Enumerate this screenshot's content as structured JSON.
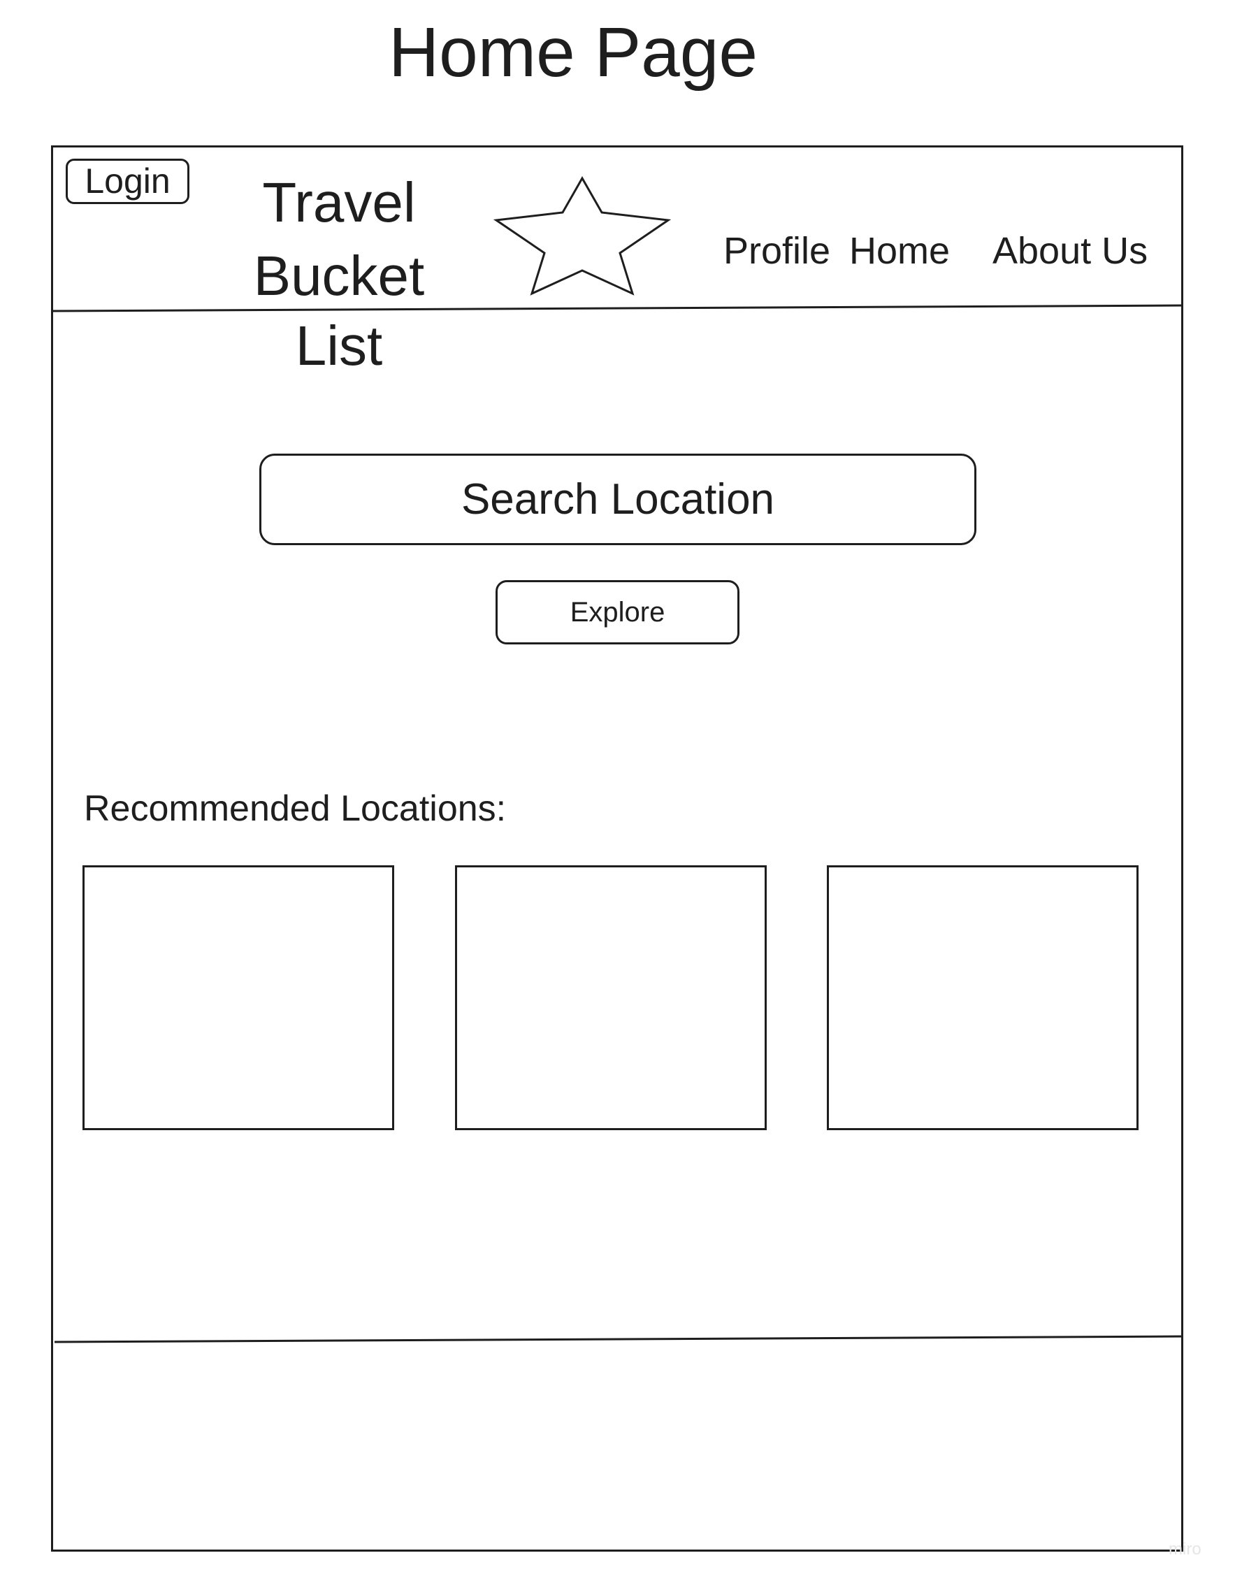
{
  "page_title": "Home Page",
  "header": {
    "login_label": "Login",
    "brand_line1": "Travel",
    "brand_line2": "Bucket List",
    "logo_icon": "star-icon",
    "nav": {
      "profile": "Profile",
      "home": "Home",
      "about": "About Us"
    }
  },
  "search": {
    "placeholder": "Search Location",
    "button_label": "Explore"
  },
  "recommended": {
    "label": "Recommended Locations:",
    "card_count": 3
  },
  "watermark": "miro",
  "colors": {
    "line": "#1e1e1e",
    "background": "#ffffff"
  }
}
